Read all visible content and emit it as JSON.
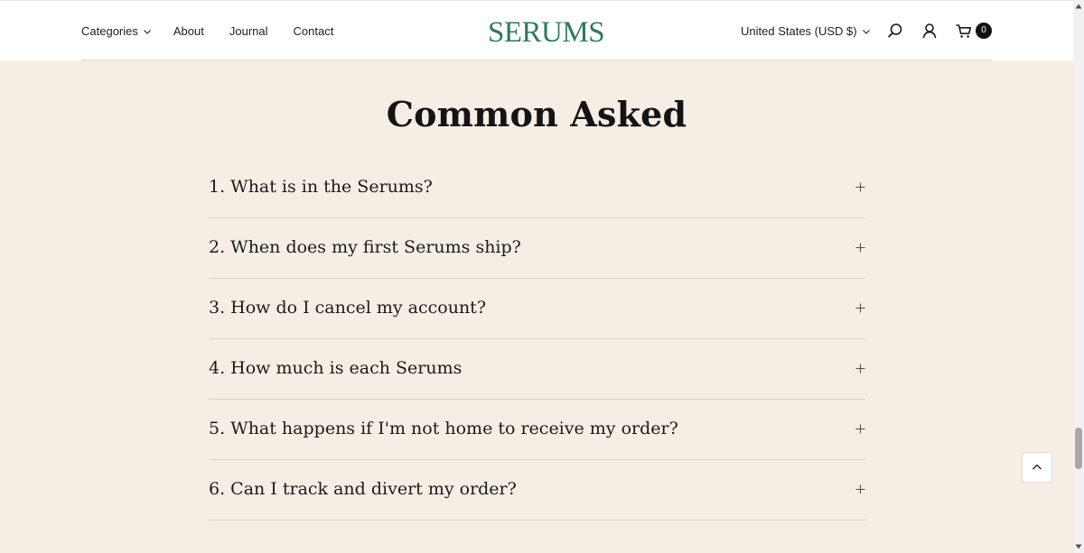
{
  "header": {
    "nav": [
      {
        "label": "Categories",
        "has_dropdown": true
      },
      {
        "label": "About"
      },
      {
        "label": "Journal"
      },
      {
        "label": "Contact"
      }
    ],
    "logo": "SERUMS",
    "currency": "United States (USD $)",
    "cart_count": "0",
    "icons": [
      "search-icon",
      "account-icon",
      "cart-icon"
    ]
  },
  "faq": {
    "title": "Common Asked",
    "items": [
      {
        "question": "1. What is in the Serums?"
      },
      {
        "question": "2. When does my first Serums ship?"
      },
      {
        "question": "3. How do I cancel my account?"
      },
      {
        "question": "4. How much is each Serums"
      },
      {
        "question": "5. What happens if I'm not home to receive my order?"
      },
      {
        "question": "6. Can I track and divert my order?"
      }
    ]
  },
  "colors": {
    "background": "#f6ede4",
    "header_bg": "#ffffff",
    "logo": "#2f7a5d",
    "text": "#1b1b1b",
    "divider": "#d9d1c9"
  }
}
